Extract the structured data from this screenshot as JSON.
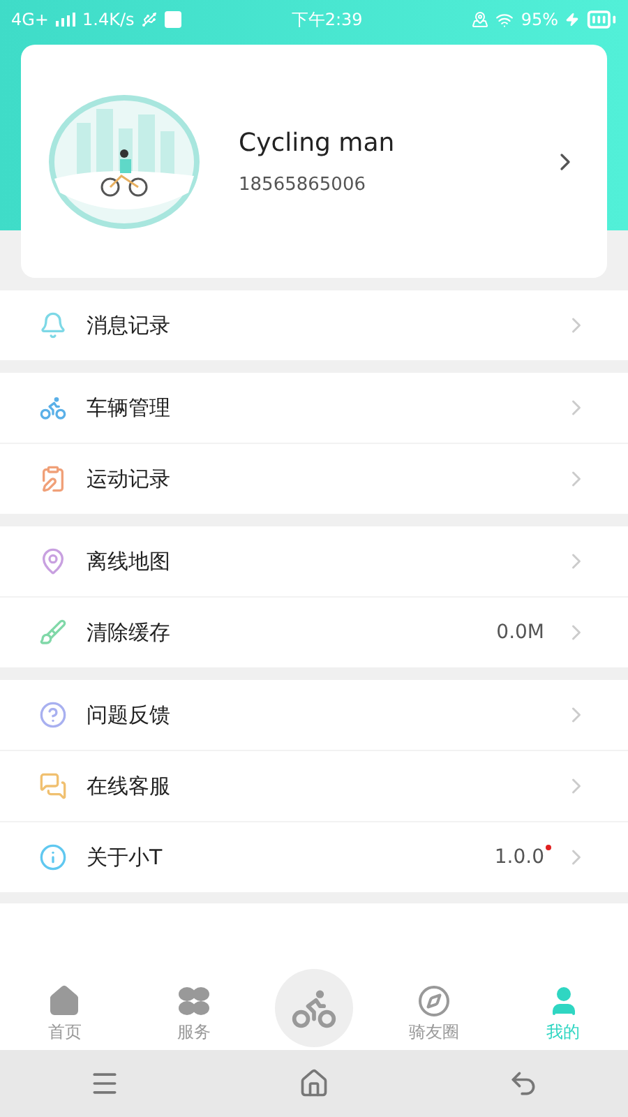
{
  "status_bar": {
    "network": "4G+",
    "speed": "1.4K/s",
    "time": "下午2:39",
    "battery": "95%"
  },
  "profile": {
    "name": "Cycling man",
    "phone": "18565865006"
  },
  "menu_groups": [
    {
      "items": [
        {
          "label": "消息记录"
        }
      ]
    },
    {
      "items": [
        {
          "label": "车辆管理"
        },
        {
          "label": "运动记录"
        }
      ]
    },
    {
      "items": [
        {
          "label": "离线地图"
        },
        {
          "label": "清除缓存",
          "value": "0.0M"
        }
      ]
    },
    {
      "items": [
        {
          "label": "问题反馈"
        },
        {
          "label": "在线客服"
        },
        {
          "label": "关于小T",
          "value": "1.0.0",
          "new_dot": true
        }
      ]
    }
  ],
  "tab_bar": [
    {
      "kind": "tab",
      "label": "首页",
      "selected": false
    },
    {
      "kind": "tab",
      "label": "服务",
      "selected": false
    },
    {
      "kind": "center",
      "selected": false
    },
    {
      "kind": "tab",
      "label": "骑友圈",
      "selected": false
    },
    {
      "kind": "tab",
      "label": "我的",
      "selected": true
    }
  ]
}
